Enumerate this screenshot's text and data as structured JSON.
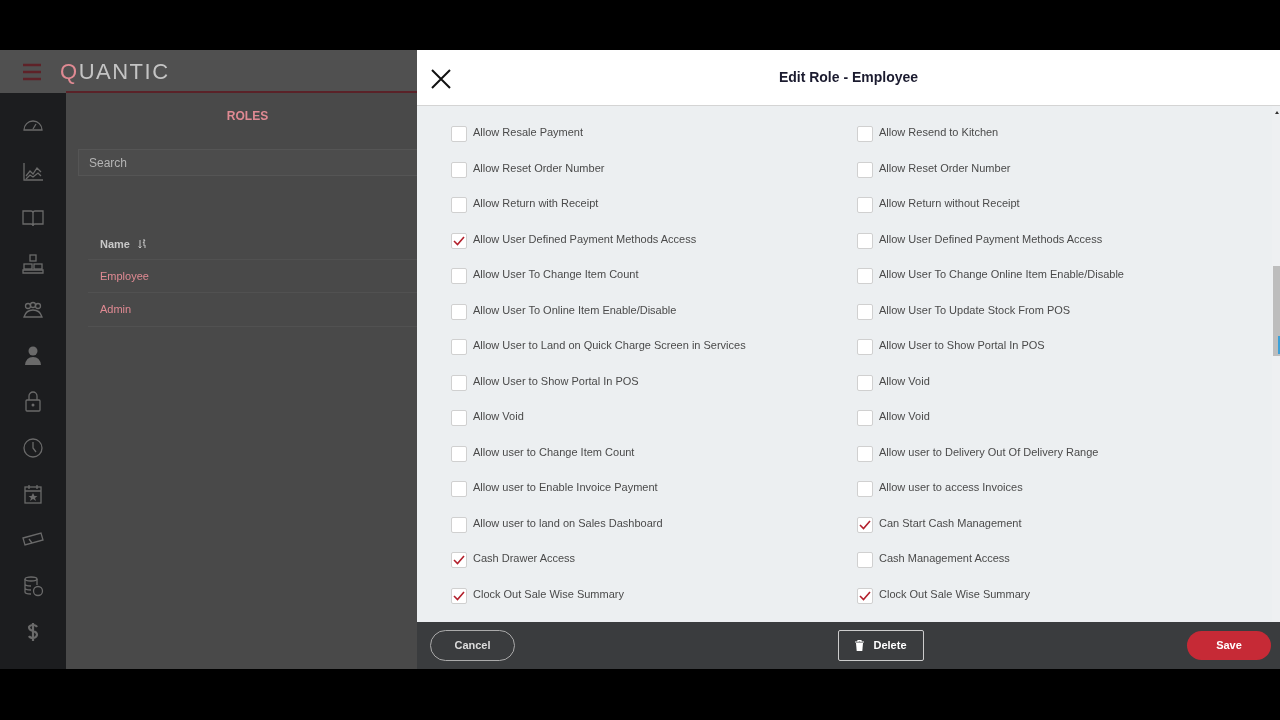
{
  "background": {
    "logo": "QUANTIC",
    "page_title": "ROLES",
    "search": {
      "placeholder": "Search"
    },
    "table": {
      "columns": [
        "Name"
      ],
      "rows": [
        "Employee",
        "Admin"
      ]
    }
  },
  "modal": {
    "title": "Edit Role - Employee",
    "rows": [
      {
        "left": {
          "label": "Allow Resale Payment",
          "checked": false
        },
        "right": {
          "label": "Allow Resend to Kitchen",
          "checked": false
        }
      },
      {
        "left": {
          "label": "Allow Reset Order Number",
          "checked": false
        },
        "right": {
          "label": "Allow Reset Order Number",
          "checked": false
        }
      },
      {
        "left": {
          "label": "Allow Return with Receipt",
          "checked": false
        },
        "right": {
          "label": "Allow Return without Receipt",
          "checked": false
        }
      },
      {
        "left": {
          "label": "Allow User Defined Payment Methods Access",
          "checked": true
        },
        "right": {
          "label": "Allow User Defined Payment Methods Access",
          "checked": false
        }
      },
      {
        "left": {
          "label": "Allow User To Change Item Count",
          "checked": false
        },
        "right": {
          "label": "Allow User To Change Online Item Enable/Disable",
          "checked": false
        }
      },
      {
        "left": {
          "label": "Allow User To Online Item Enable/Disable",
          "checked": false
        },
        "right": {
          "label": "Allow User To Update Stock From POS",
          "checked": false
        }
      },
      {
        "left": {
          "label": "Allow User to Land on Quick Charge Screen in Services",
          "checked": false
        },
        "right": {
          "label": "Allow User to Show Portal In POS",
          "checked": false
        }
      },
      {
        "left": {
          "label": "Allow User to Show Portal In POS",
          "checked": false
        },
        "right": {
          "label": "Allow Void",
          "checked": false
        }
      },
      {
        "left": {
          "label": "Allow Void",
          "checked": false
        },
        "right": {
          "label": "Allow Void",
          "checked": false
        }
      },
      {
        "left": {
          "label": "Allow user to Change Item Count",
          "checked": false
        },
        "right": {
          "label": "Allow user to Delivery Out Of Delivery Range",
          "checked": false
        }
      },
      {
        "left": {
          "label": "Allow user to Enable Invoice Payment",
          "checked": false
        },
        "right": {
          "label": "Allow user to access Invoices",
          "checked": false
        }
      },
      {
        "left": {
          "label": "Allow user to land on Sales Dashboard",
          "checked": false
        },
        "right": {
          "label": "Can Start Cash Management",
          "checked": true
        }
      },
      {
        "left": {
          "label": "Cash Drawer Access",
          "checked": true
        },
        "right": {
          "label": "Cash Management Access",
          "checked": false
        }
      },
      {
        "left": {
          "label": "Clock Out Sale Wise Summary",
          "checked": true
        },
        "right": {
          "label": "Clock Out Sale Wise Summary",
          "checked": true
        }
      }
    ],
    "footer": {
      "cancel": "Cancel",
      "delete": "Delete",
      "save": "Save"
    }
  }
}
